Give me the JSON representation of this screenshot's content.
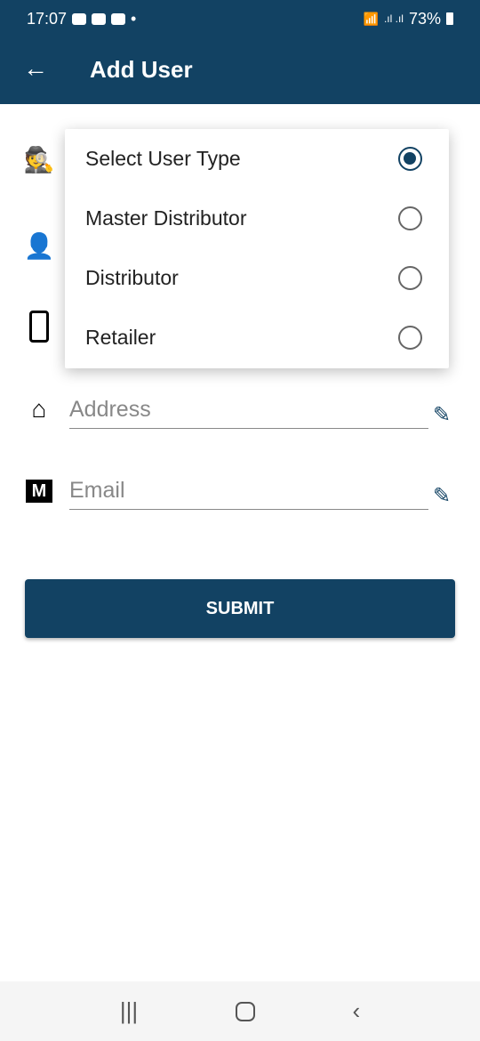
{
  "status": {
    "time": "17:07",
    "battery": "73%"
  },
  "header": {
    "title": "Add User",
    "back_icon": "arrow-left-icon"
  },
  "form": {
    "address_placeholder": "Address",
    "email_placeholder": "Email",
    "submit_label": "SUBMIT"
  },
  "dropdown": {
    "options": [
      {
        "label": "Select User Type",
        "selected": true
      },
      {
        "label": "Master Distributor",
        "selected": false
      },
      {
        "label": "Distributor",
        "selected": false
      },
      {
        "label": "Retailer",
        "selected": false
      }
    ]
  },
  "colors": {
    "primary": "#124263"
  }
}
